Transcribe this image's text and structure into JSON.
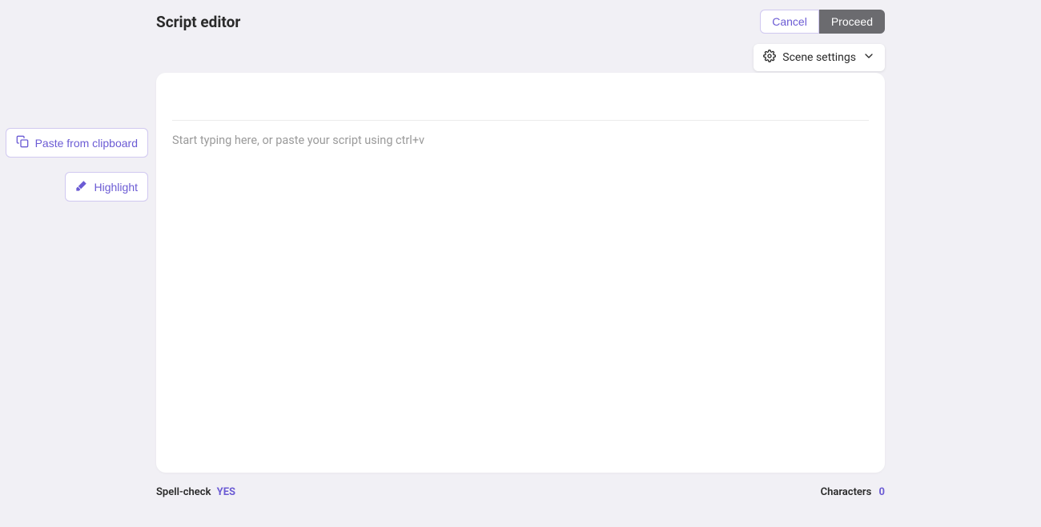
{
  "header": {
    "title": "Script editor",
    "cancel_label": "Cancel",
    "proceed_label": "Proceed"
  },
  "scene_settings": {
    "label": "Scene settings"
  },
  "side_actions": {
    "paste_label": "Paste from clipboard",
    "highlight_label": "Highlight"
  },
  "editor": {
    "placeholder": "Start typing here, or paste your script using ctrl+v"
  },
  "footer": {
    "spellcheck_label": "Spell-check",
    "spellcheck_value": "YES",
    "characters_label": "Characters",
    "characters_value": "0"
  }
}
